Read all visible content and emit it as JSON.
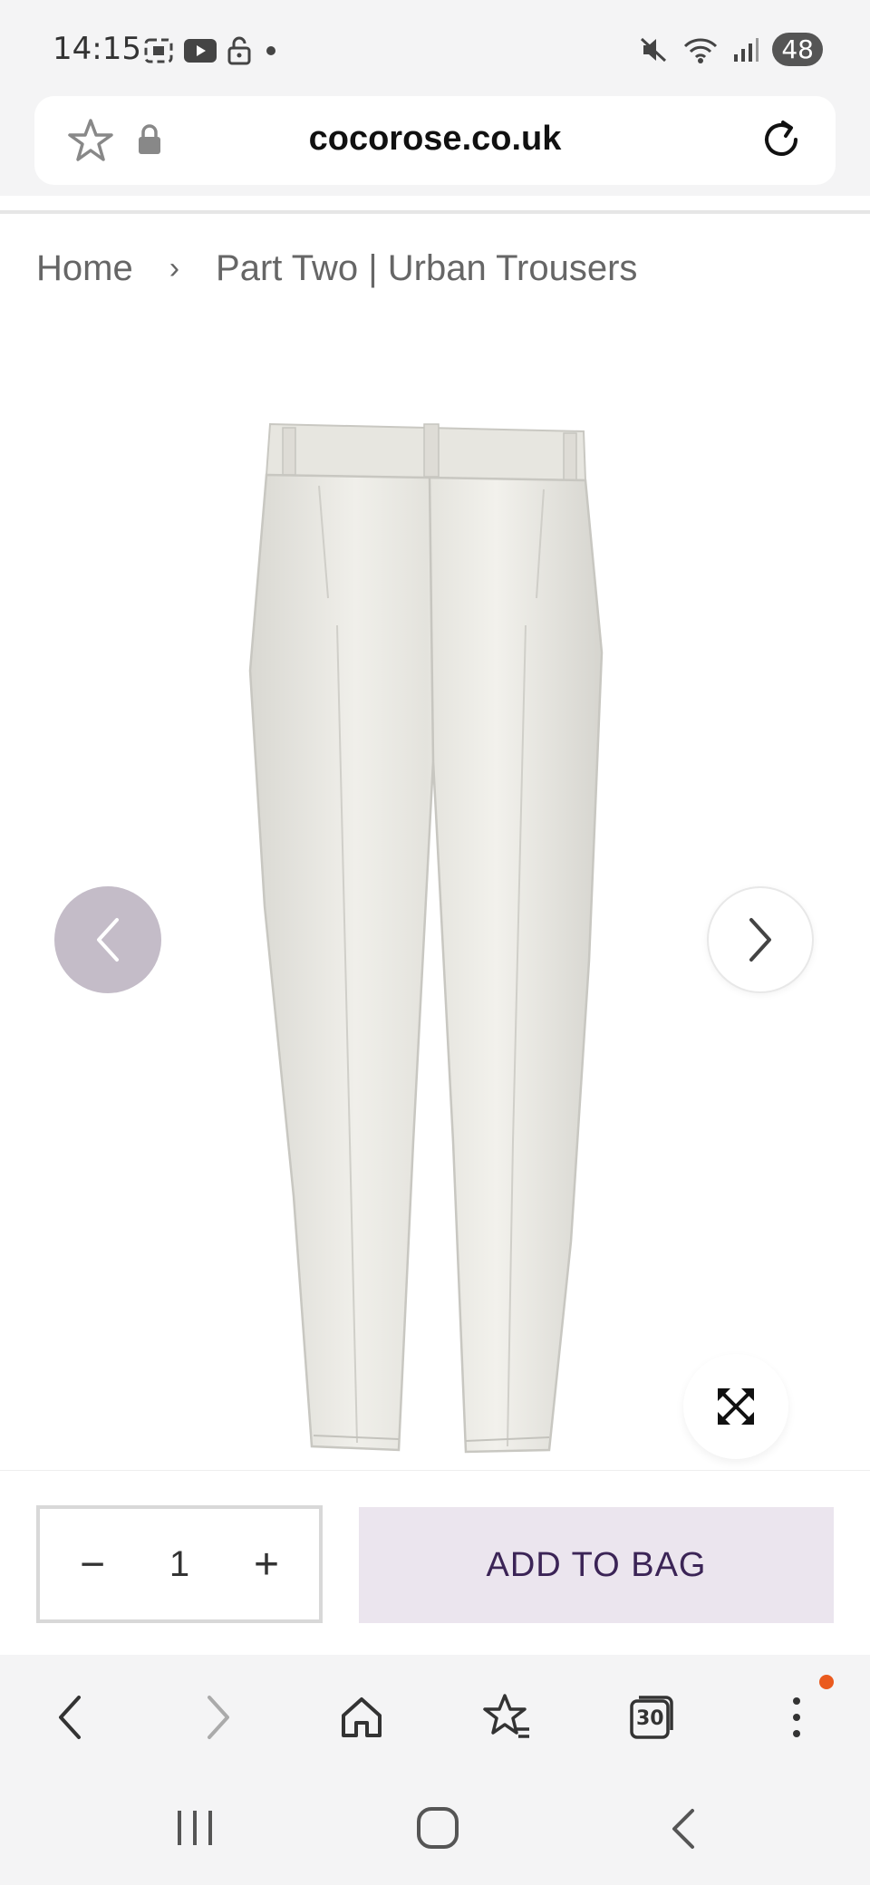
{
  "status_bar": {
    "time": "14:15",
    "battery": "48"
  },
  "browser": {
    "url": "cocorose.co.uk",
    "tab_count": "30"
  },
  "breadcrumb": {
    "home": "Home",
    "separator": "›",
    "current": "Part Two | Urban Trousers"
  },
  "product": {
    "image_icon": "trousers-image",
    "gallery_prev_icon": "chevron-left-icon",
    "gallery_next_icon": "chevron-right-icon",
    "expand_icon": "expand-icon"
  },
  "purchase": {
    "minus_label": "−",
    "quantity": "1",
    "plus_label": "+",
    "add_to_bag": "ADD TO BAG"
  },
  "colors": {
    "accent_button_bg": "#ebe5ee",
    "accent_button_text": "#3b2456",
    "nav_prev_bg": "#c4bcc8",
    "notification_dot": "#ea5a1e"
  }
}
